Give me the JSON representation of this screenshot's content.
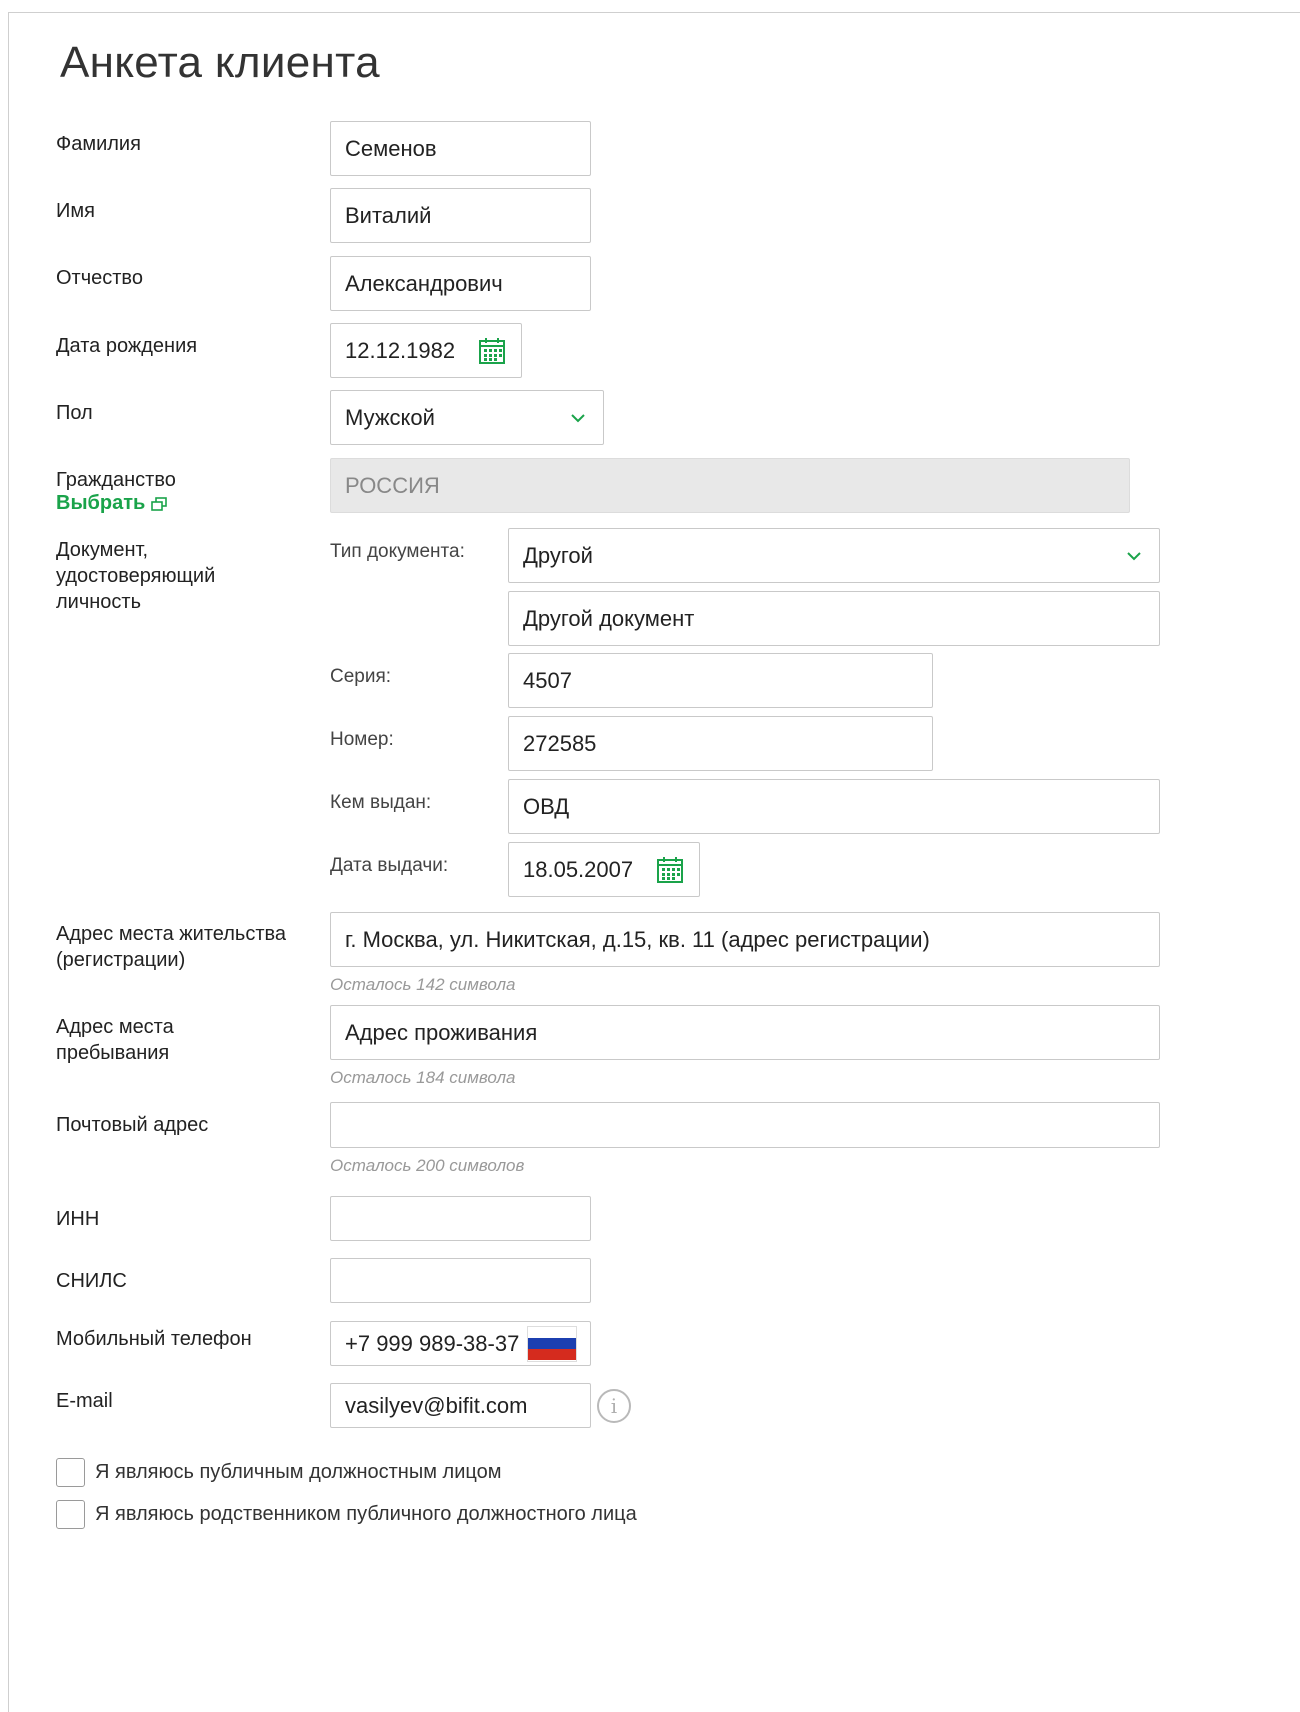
{
  "page": {
    "title": "Анкета клиента"
  },
  "fields": {
    "surname": {
      "label": "Фамилия",
      "value": "Семенов"
    },
    "name": {
      "label": "Имя",
      "value": "Виталий"
    },
    "patronymic": {
      "label": "Отчество",
      "value": "Александрович"
    },
    "birth_date": {
      "label": "Дата рождения",
      "value": "12.12.1982",
      "icon": "calendar-icon"
    },
    "gender": {
      "label": "Пол",
      "value": "Мужской",
      "icon": "chevron-down-icon"
    },
    "citizenship": {
      "label": "Гражданство",
      "link": "Выбрать",
      "link_icon": "external-window-icon",
      "value": "РОССИЯ"
    },
    "identity_document": {
      "label": "Документ, удостоверяющий личность",
      "type_label": "Тип документа:",
      "type_value": "Другой",
      "type_name_value": "Другой документ",
      "series_label": "Серия:",
      "series_value": "4507",
      "number_label": "Номер:",
      "number_value": "272585",
      "issued_by_label": "Кем выдан:",
      "issued_by_value": "ОВД",
      "issue_date_label": "Дата выдачи:",
      "issue_date_value": "18.05.2007"
    },
    "registration_address": {
      "label": "Адрес места жительства (регистрации)",
      "value": "г. Москва, ул. Никитская, д.15, кв. 11 (адрес регистрации)",
      "hint": "Осталось 142 символа"
    },
    "stay_address": {
      "label": "Адрес места пребывания",
      "value": "Адрес проживания",
      "hint": "Осталось 184 символа"
    },
    "postal_address": {
      "label": "Почтовый адрес",
      "value": "",
      "hint": "Осталось 200 символов"
    },
    "inn": {
      "label": "ИНН",
      "value": ""
    },
    "snils": {
      "label": "СНИЛС",
      "value": ""
    },
    "mobile_phone": {
      "label": "Мобильный телефон",
      "value": "+7 999 989-38-37",
      "icon": "russia-flag-icon"
    },
    "email": {
      "label": "E-mail",
      "value": "vasilyev@bifit.com",
      "icon": "info-icon"
    }
  },
  "checkboxes": [
    {
      "label": "Я являюсь публичным должностным лицом",
      "checked": false
    },
    {
      "label": "Я являюсь родственником публичного должностного лица",
      "checked": false
    }
  ],
  "colors": {
    "accent": "#1aa34a",
    "border": "#c9c9c9",
    "disabled_bg": "#e8e8e8",
    "hint": "#999999",
    "flag_white": "#ffffff",
    "flag_blue": "#1c3fb0",
    "flag_red": "#d52b1e"
  }
}
